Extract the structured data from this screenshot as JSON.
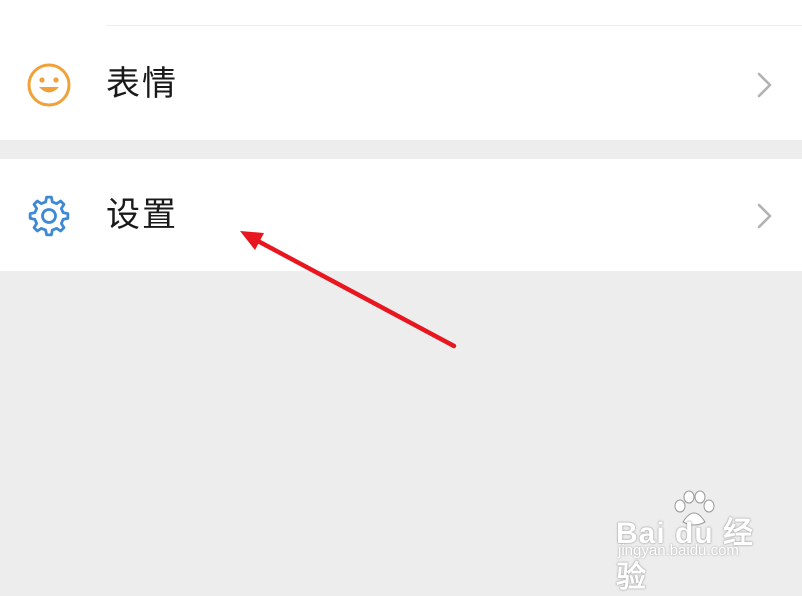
{
  "menu": {
    "items": [
      {
        "label": "表情",
        "icon": "smiley-face-icon",
        "icon_color": "#f0a13a"
      },
      {
        "label": "设置",
        "icon": "gear-icon",
        "icon_color": "#3d89d8"
      }
    ]
  },
  "annotation": {
    "arrow_color": "#e8161f"
  },
  "watermark": {
    "brand": "Bai du 经验",
    "url": "jingyan.baidu.com"
  }
}
